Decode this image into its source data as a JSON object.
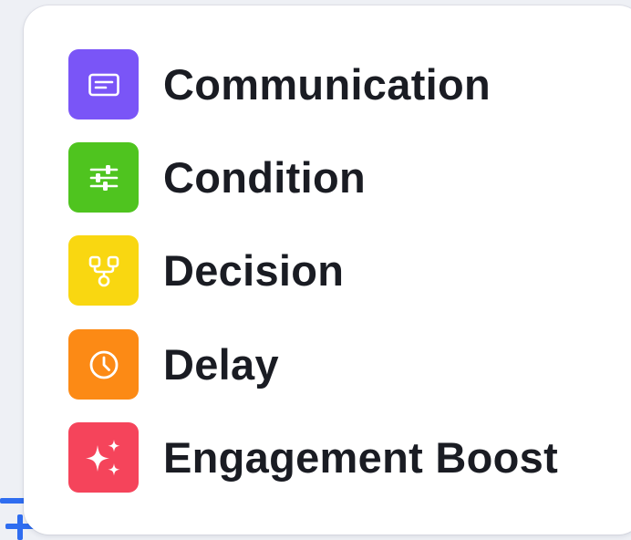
{
  "menu": {
    "items": [
      {
        "label": "Communication",
        "icon": "message-card-icon",
        "color": "#7a55f7"
      },
      {
        "label": "Condition",
        "icon": "sliders-icon",
        "color": "#4fc41f"
      },
      {
        "label": "Decision",
        "icon": "branch-icon",
        "color": "#f9d711"
      },
      {
        "label": "Delay",
        "icon": "clock-icon",
        "color": "#fc8a15"
      },
      {
        "label": "Engagement Boost",
        "icon": "sparkle-icon",
        "color": "#f5445b"
      }
    ]
  },
  "add_handle": {
    "icon": "plus-icon",
    "color": "#2f6df0"
  }
}
